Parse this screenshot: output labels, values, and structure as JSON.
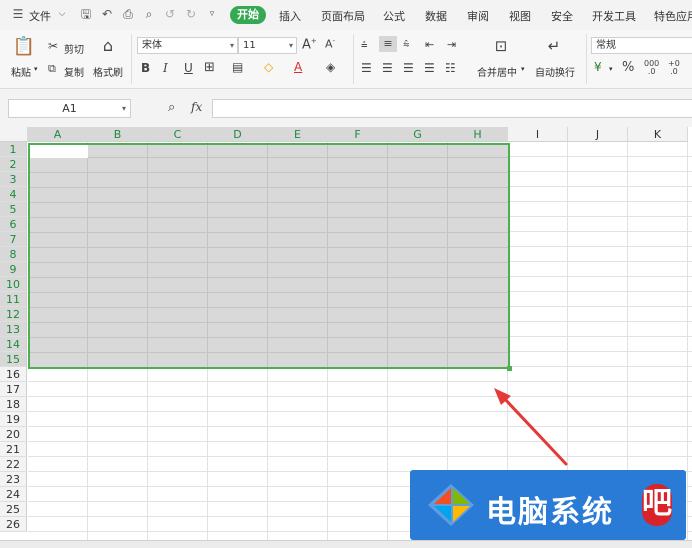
{
  "menubar": {
    "file_label": "文件",
    "tabs": [
      "开始",
      "插入",
      "页面布局",
      "公式",
      "数据",
      "审阅",
      "视图",
      "安全",
      "开发工具",
      "特色应用"
    ],
    "colors": {
      "active_tab": "#35a853"
    }
  },
  "ribbon": {
    "paste_label": "粘贴",
    "cut_label": "剪切",
    "copy_label": "复制",
    "format_painter_label": "格式刷",
    "font_name": "宋体",
    "font_size": "11",
    "merge_label": "合并居中",
    "wrap_label": "自动换行",
    "number_format": "常规",
    "percent_symbol": "%"
  },
  "formula_bar": {
    "name_box": "A1",
    "fx_label": "fx",
    "value": ""
  },
  "sheet": {
    "columns": [
      "A",
      "B",
      "C",
      "D",
      "E",
      "F",
      "G",
      "H",
      "I",
      "J",
      "K"
    ],
    "rows": [
      "1",
      "2",
      "3",
      "4",
      "5",
      "6",
      "7",
      "8",
      "9",
      "10",
      "11",
      "12",
      "13",
      "14",
      "15",
      "16",
      "17",
      "18",
      "19",
      "20",
      "21",
      "22",
      "23",
      "24",
      "25",
      "26"
    ],
    "selected_range": "A1:H15",
    "colors": {
      "selection_fill": "#d9d9d9",
      "selection_border": "#4caf50"
    }
  },
  "annotation": {
    "watermark_text": "电脑系统",
    "watermark_last_char": "吧",
    "colors": {
      "arrow": "#e53935",
      "watermark_bg": "#2a7bd6"
    }
  }
}
